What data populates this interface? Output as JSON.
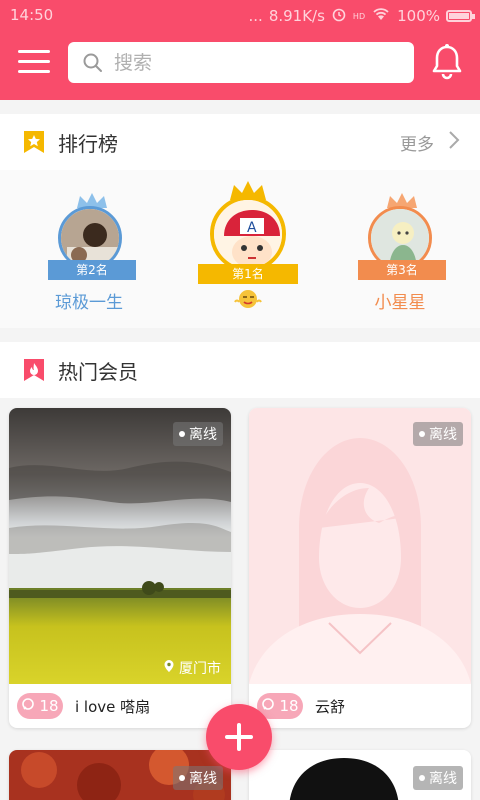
{
  "status_bar": {
    "time": "14:50",
    "dots": "...",
    "speed": "8.91K/s",
    "hd": "HD",
    "battery": "100%"
  },
  "header": {
    "search_placeholder": "搜索"
  },
  "leaderboard": {
    "title": "排行榜",
    "more": "更多",
    "entries": [
      {
        "rank_label": "第2名",
        "name": "琼极一生",
        "color": "#5b9ad6"
      },
      {
        "rank_label": "第1名",
        "name": "",
        "color": "#f5b800"
      },
      {
        "rank_label": "第3名",
        "name": "小星星",
        "color": "#f28c4e"
      }
    ]
  },
  "hot_members": {
    "title": "热门会员",
    "cards": [
      {
        "status": "离线",
        "location": "厦门市",
        "likes": "18",
        "name": "i love 嗒扇"
      },
      {
        "status": "离线",
        "location": "",
        "likes": "18",
        "name": "云舒"
      },
      {
        "status": "离线"
      },
      {
        "status": "离线"
      }
    ]
  },
  "colors": {
    "accent": "#f94c6b",
    "star": "#f5b800"
  }
}
